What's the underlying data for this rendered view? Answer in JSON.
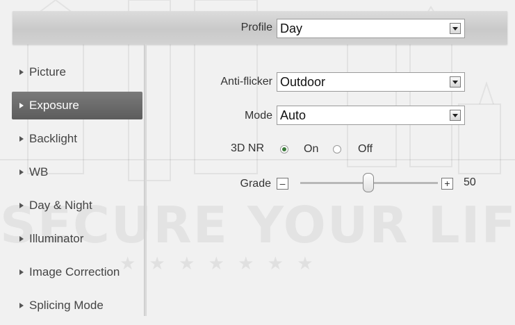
{
  "profile": {
    "label": "Profile",
    "value": "Day"
  },
  "sidebar": {
    "items": [
      {
        "label": "Picture",
        "active": false
      },
      {
        "label": "Exposure",
        "active": true
      },
      {
        "label": "Backlight",
        "active": false
      },
      {
        "label": "WB",
        "active": false
      },
      {
        "label": "Day & Night",
        "active": false
      },
      {
        "label": "Illuminator",
        "active": false
      },
      {
        "label": "Image Correction",
        "active": false
      },
      {
        "label": "Splicing Mode",
        "active": false
      }
    ]
  },
  "form": {
    "anti_flicker": {
      "label": "Anti-flicker",
      "value": "Outdoor"
    },
    "mode": {
      "label": "Mode",
      "value": "Auto"
    },
    "nr3d": {
      "label": "3D NR",
      "on_label": "On",
      "off_label": "Off",
      "selected": "On"
    },
    "grade": {
      "label": "Grade",
      "minus": "–",
      "plus": "+",
      "value": "50"
    }
  },
  "watermark": {
    "text": "SECURE YOUR LIFE",
    "stars": "★ ★ ★ ★ ★ ★ ★"
  },
  "colors": {
    "active_item": "#666666",
    "radio_checked": "#3a7a3a"
  }
}
